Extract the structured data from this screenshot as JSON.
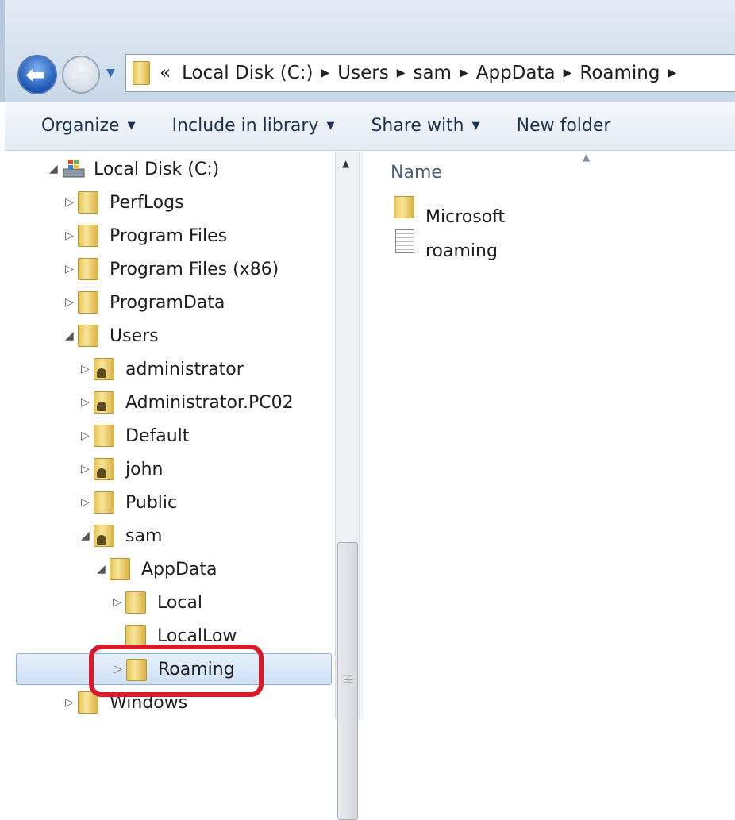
{
  "nav": {
    "back_icon": "back-arrow-icon",
    "forward_icon": "forward-arrow-icon"
  },
  "address": {
    "overflow": "«",
    "segments": [
      "Local Disk (C:)",
      "Users",
      "sam",
      "AppData",
      "Roaming"
    ]
  },
  "toolbar": {
    "organize": "Organize",
    "include": "Include in library",
    "share": "Share with",
    "new_folder": "New folder"
  },
  "tree": [
    {
      "label": "Local Disk (C:)",
      "level": 0,
      "state": "expanded",
      "icon": "drive"
    },
    {
      "label": "PerfLogs",
      "level": 1,
      "state": "collapsed",
      "icon": "folder"
    },
    {
      "label": "Program Files",
      "level": 1,
      "state": "collapsed",
      "icon": "folder"
    },
    {
      "label": "Program Files (x86)",
      "level": 1,
      "state": "collapsed",
      "icon": "folder"
    },
    {
      "label": "ProgramData",
      "level": 1,
      "state": "collapsed",
      "icon": "folder"
    },
    {
      "label": "Users",
      "level": 1,
      "state": "expanded",
      "icon": "folder"
    },
    {
      "label": "administrator",
      "level": 2,
      "state": "collapsed",
      "icon": "user-folder"
    },
    {
      "label": "Administrator.PC02",
      "level": 2,
      "state": "collapsed",
      "icon": "user-folder"
    },
    {
      "label": "Default",
      "level": 2,
      "state": "collapsed",
      "icon": "folder"
    },
    {
      "label": "john",
      "level": 2,
      "state": "collapsed",
      "icon": "user-folder"
    },
    {
      "label": "Public",
      "level": 2,
      "state": "collapsed",
      "icon": "folder"
    },
    {
      "label": "sam",
      "level": 2,
      "state": "expanded",
      "icon": "user-folder"
    },
    {
      "label": "AppData",
      "level": 3,
      "state": "expanded",
      "icon": "folder"
    },
    {
      "label": "Local",
      "level": 4,
      "state": "collapsed",
      "icon": "folder"
    },
    {
      "label": "LocalLow",
      "level": 4,
      "state": "none",
      "icon": "folder"
    },
    {
      "label": "Roaming",
      "level": 4,
      "state": "collapsed",
      "icon": "folder",
      "selected": true
    },
    {
      "label": "Windows",
      "level": 1,
      "state": "collapsed",
      "icon": "folder"
    }
  ],
  "content": {
    "column_name": "Name",
    "items": [
      {
        "label": "Microsoft",
        "icon": "folder"
      },
      {
        "label": "roaming",
        "icon": "text-file"
      }
    ]
  },
  "colors": {
    "highlight": "#d81b2a",
    "selection": "#cfe0f6"
  }
}
